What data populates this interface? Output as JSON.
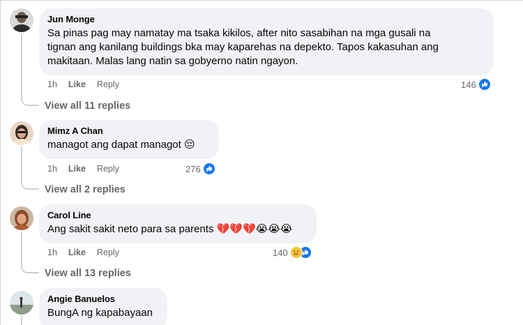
{
  "comments": [
    {
      "author": "Jun Monge",
      "text": "Sa pinas pag may namatay ma tsaka kikilos, after nito sasabihan na mga gusali na\ntignan ang kanilang buildings bka may kaparehas na depekto. Tapos kakasuhan ang\nmakitaan. Malas lang natin sa gobyerno natin ngayon.",
      "time": "1h",
      "like_label": "Like",
      "reply_label": "Reply",
      "reaction_count": "146",
      "reactions": [
        "like"
      ],
      "view_replies": "View all 11 replies"
    },
    {
      "author": "Mimz A Chan",
      "text": "managot ang dapat managot 😔",
      "time": "1h",
      "like_label": "Like",
      "reply_label": "Reply",
      "reaction_count": "276",
      "reactions": [
        "like"
      ],
      "view_replies": "View all 2 replies"
    },
    {
      "author": "Carol Line",
      "text": "Ang sakit sakit neto para sa parents 💔💔💔😭😭😭",
      "time": "1h",
      "like_label": "Like",
      "reply_label": "Reply",
      "reaction_count": "140",
      "reactions": [
        "sad",
        "like"
      ],
      "view_replies": "View all 13 replies"
    },
    {
      "author": "Angie Banuelos",
      "text": "BungA ng kapabayaan"
    }
  ],
  "colors": {
    "bubble": "#f0f2f5",
    "like_blue": "#1877f2",
    "sad_yellow": "#f7c33b",
    "meta_gray": "#65676b"
  }
}
